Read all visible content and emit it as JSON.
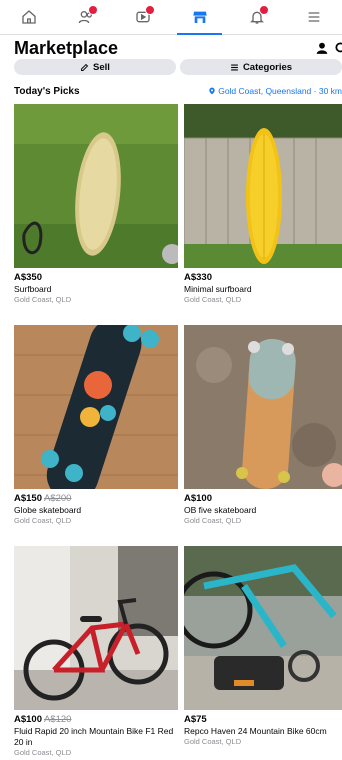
{
  "header": {
    "title": "Marketplace"
  },
  "actions": {
    "sell_label": "Sell",
    "categories_label": "Categories"
  },
  "picks": {
    "title": "Today's Picks",
    "location": "Gold Coast, Queensland · 30 km"
  },
  "listings": [
    {
      "price": "A$350",
      "old_price": "",
      "name": "Surfboard",
      "location": "Gold Coast, QLD"
    },
    {
      "price": "A$330",
      "old_price": "",
      "name": "Minimal surfboard",
      "location": "Gold Coast, QLD"
    },
    {
      "price": "A$150",
      "old_price": "A$200",
      "name": "Globe skateboard",
      "location": "Gold Coast, QLD"
    },
    {
      "price": "A$100",
      "old_price": "",
      "name": "OB five skateboard",
      "location": "Gold Coast, QLD"
    },
    {
      "price": "A$100",
      "old_price": "A$120",
      "name": "Fluid Rapid 20 inch Mountain Bike F1 Red 20 in",
      "location": "Gold Coast, QLD"
    },
    {
      "price": "A$75",
      "old_price": "",
      "name": "Repco Haven 24 Mountain Bike 60cm",
      "location": "Gold Coast, QLD"
    }
  ],
  "colors": {
    "accent": "#1877f2",
    "badge": "#e41e3f",
    "pill_bg": "#e4e6eb"
  },
  "icons": [
    "home-icon",
    "friends-icon",
    "video-icon",
    "marketplace-icon",
    "notifications-icon",
    "menu-icon",
    "profile-icon",
    "search-icon",
    "sell-icon",
    "categories-icon",
    "location-pin-icon"
  ]
}
